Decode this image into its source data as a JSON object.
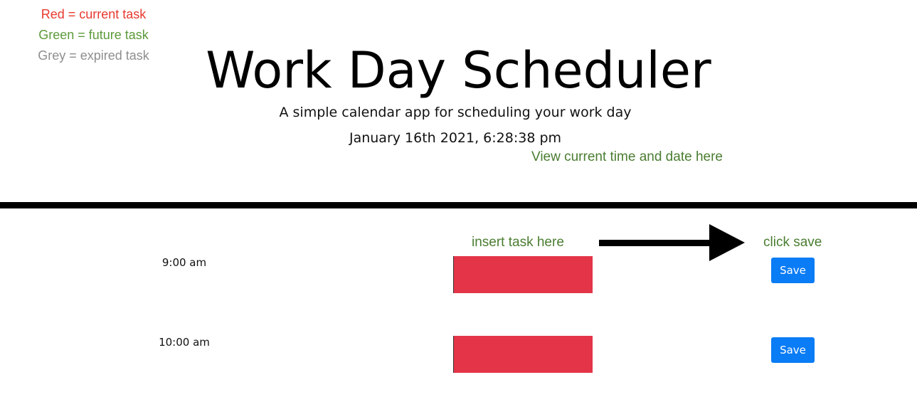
{
  "legend": {
    "current": "Red = current task",
    "future": "Green = future task",
    "expired": "Grey = expired task"
  },
  "header": {
    "title": "Work Day Scheduler",
    "subtitle": "A simple calendar app for scheduling your work day",
    "datetime": "January 16th 2021, 6:28:38 pm"
  },
  "annotations": {
    "time_note": "View current time and date here",
    "insert_note": "insert task here",
    "save_note": "click save"
  },
  "rows": [
    {
      "hour": "9:00 am",
      "task": "",
      "save_label": "Save",
      "status": "current"
    },
    {
      "hour": "10:00 am",
      "task": "",
      "save_label": "Save",
      "status": "current"
    }
  ],
  "colors": {
    "current": "#e43548",
    "save_button": "#0a7cf5",
    "annotation_green": "#4a7d31",
    "legend_red": "#e8392f",
    "legend_green": "#5c9a3a",
    "legend_grey": "#8e8e8e"
  }
}
